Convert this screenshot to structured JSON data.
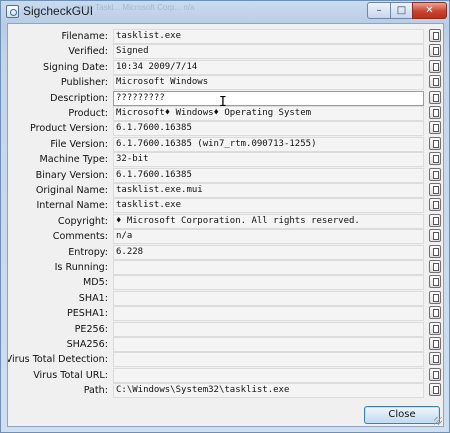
{
  "window": {
    "title": "SigcheckGUI",
    "ghost_text": "...ame          Taskl...        Microsoft Corp...   n/a"
  },
  "fields": [
    {
      "label": "Filename:",
      "value": "tasklist.exe"
    },
    {
      "label": "Verified:",
      "value": "Signed"
    },
    {
      "label": "Signing Date:",
      "value": "10:34 2009/7/14"
    },
    {
      "label": "Publisher:",
      "value": "Microsoft Windows"
    },
    {
      "label": "Description:",
      "value": "?????????"
    },
    {
      "label": "Product:",
      "value": "Microsoft♦ Windows♦ Operating System"
    },
    {
      "label": "Product Version:",
      "value": "6.1.7600.16385"
    },
    {
      "label": "File Version:",
      "value": "6.1.7600.16385 (win7_rtm.090713-1255)"
    },
    {
      "label": "Machine Type:",
      "value": "32-bit"
    },
    {
      "label": "Binary Version:",
      "value": "6.1.7600.16385"
    },
    {
      "label": "Original Name:",
      "value": "tasklist.exe.mui"
    },
    {
      "label": "Internal Name:",
      "value": "tasklist.exe"
    },
    {
      "label": "Copyright:",
      "value": "♦ Microsoft Corporation. All rights reserved."
    },
    {
      "label": "Comments:",
      "value": "n/a"
    },
    {
      "label": "Entropy:",
      "value": "6.228"
    },
    {
      "label": "Is Running:",
      "value": ""
    },
    {
      "label": "MD5:",
      "value": ""
    },
    {
      "label": "SHA1:",
      "value": ""
    },
    {
      "label": "PESHA1:",
      "value": ""
    },
    {
      "label": "PE256:",
      "value": ""
    },
    {
      "label": "SHA256:",
      "value": ""
    },
    {
      "label": "Virus Total Detection:",
      "value": ""
    },
    {
      "label": "Virus Total URL:",
      "value": ""
    },
    {
      "label": "Path:",
      "value": "C:\\Windows\\System32\\tasklist.exe"
    }
  ],
  "buttons": {
    "close_label": "Close",
    "title_minimize": "–",
    "title_maximize": "□",
    "title_close": "✕"
  }
}
